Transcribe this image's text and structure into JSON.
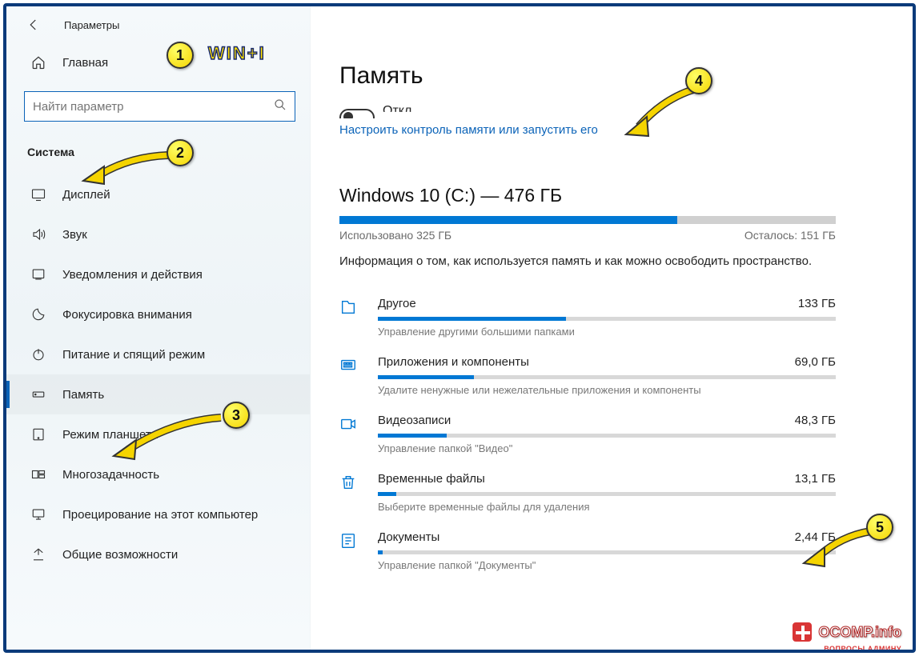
{
  "window": {
    "title": "Параметры"
  },
  "sidebar": {
    "home": "Главная",
    "search_placeholder": "Найти параметр",
    "section": "Система",
    "items": [
      {
        "icon": "display",
        "label": "Дисплей"
      },
      {
        "icon": "sound",
        "label": "Звук"
      },
      {
        "icon": "notify",
        "label": "Уведомления и действия"
      },
      {
        "icon": "focus",
        "label": "Фокусировка внимания"
      },
      {
        "icon": "power",
        "label": "Питание и спящий режим"
      },
      {
        "icon": "storage",
        "label": "Память",
        "selected": true
      },
      {
        "icon": "tablet",
        "label": "Режим планшета"
      },
      {
        "icon": "multi",
        "label": "Многозадачность"
      },
      {
        "icon": "project",
        "label": "Проецирование на этот компьютер"
      },
      {
        "icon": "shared",
        "label": "Общие возможности"
      }
    ]
  },
  "main": {
    "title": "Память",
    "toggle_off": "Откл.",
    "sense_link": "Настроить контроль памяти или запустить его",
    "drive_title": "Windows 10 (C:) — 476 ГБ",
    "used_label": "Использовано 325 ГБ",
    "free_label": "Осталось: 151 ГБ",
    "used_pct": 68,
    "info": "Информация о том, как используется память и как можно освободить пространство.",
    "categories": [
      {
        "icon": "other",
        "name": "Другое",
        "size": "133 ГБ",
        "pct": 41,
        "desc": "Управление другими большими папками"
      },
      {
        "icon": "apps",
        "name": "Приложения и компоненты",
        "size": "69,0 ГБ",
        "pct": 21,
        "desc": "Удалите ненужные или нежелательные приложения и компоненты"
      },
      {
        "icon": "video",
        "name": "Видеозаписи",
        "size": "48,3 ГБ",
        "pct": 15,
        "desc": "Управление папкой \"Видео\""
      },
      {
        "icon": "temp",
        "name": "Временные файлы",
        "size": "13,1 ГБ",
        "pct": 4,
        "desc": "Выберите временные файлы для удаления"
      },
      {
        "icon": "docs",
        "name": "Документы",
        "size": "2,44 ГБ",
        "pct": 1,
        "desc": "Управление папкой \"Документы\""
      }
    ]
  },
  "annotations": {
    "hotkey": "WIN+I",
    "n1": "1",
    "n2": "2",
    "n3": "3",
    "n4": "4",
    "n5": "5"
  },
  "watermark": {
    "main": "OCOMP.info",
    "sub": "ВОПРОСЫ АДМИНУ"
  }
}
